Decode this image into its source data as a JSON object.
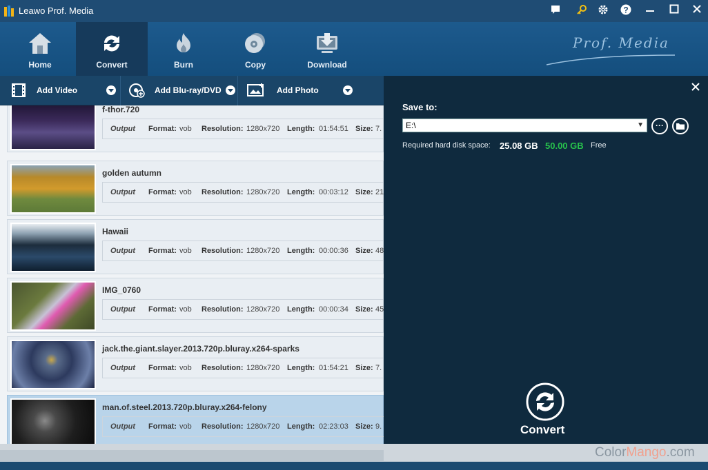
{
  "window": {
    "title": "Leawo Prof. Media",
    "controls": [
      "chat-icon",
      "key-icon",
      "settings-icon",
      "help-icon",
      "minimize-icon",
      "maximize-icon",
      "close-icon"
    ]
  },
  "nav": {
    "items": [
      {
        "label": "Home",
        "icon": "home-icon",
        "active": false
      },
      {
        "label": "Convert",
        "icon": "convert-icon",
        "active": true
      },
      {
        "label": "Burn",
        "icon": "burn-icon",
        "active": false
      },
      {
        "label": "Copy",
        "icon": "copy-icon",
        "active": false
      },
      {
        "label": "Download",
        "icon": "download-icon",
        "active": false
      }
    ],
    "brand": "Prof. Media"
  },
  "toolbar": {
    "add_video": "Add Video",
    "add_bluray": "Add Blu-ray/DVD",
    "add_photo": "Add Photo"
  },
  "list": {
    "output_label": "Output",
    "format_key": "Format:",
    "resolution_key": "Resolution:",
    "length_key": "Length:",
    "size_key": "Size:",
    "items": [
      {
        "title": "f-thor.720",
        "format": "vob",
        "resolution": "1280x720",
        "length": "01:54:51",
        "size": "7.",
        "selected": false
      },
      {
        "title": "golden autumn",
        "format": "vob",
        "resolution": "1280x720",
        "length": "00:03:12",
        "size": "21",
        "selected": false
      },
      {
        "title": "Hawaii",
        "format": "vob",
        "resolution": "1280x720",
        "length": "00:00:36",
        "size": "48",
        "selected": false
      },
      {
        "title": "IMG_0760",
        "format": "vob",
        "resolution": "1280x720",
        "length": "00:00:34",
        "size": "45",
        "selected": false
      },
      {
        "title": "jack.the.giant.slayer.2013.720p.bluray.x264-sparks",
        "format": "vob",
        "resolution": "1280x720",
        "length": "01:54:21",
        "size": "7.",
        "selected": false
      },
      {
        "title": "man.of.steel.2013.720p.bluray.x264-felony",
        "format": "vob",
        "resolution": "1280x720",
        "length": "02:23:03",
        "size": "9.",
        "selected": true
      }
    ]
  },
  "panel": {
    "save_to_label": "Save to:",
    "save_to_value": "E:\\",
    "required_label": "Required hard disk space:",
    "required_value": "25.08 GB",
    "free_value": "50.00 GB",
    "free_label": "Free",
    "convert_label": "Convert"
  },
  "colors": {
    "accent": "#1d5a8d",
    "panel_bg": "#0f2a3e",
    "free_green": "#27c24c",
    "selected_row": "#b9d4ea"
  },
  "watermark": {
    "part1": "Color",
    "part2": "Mango",
    "part3": ".com"
  }
}
